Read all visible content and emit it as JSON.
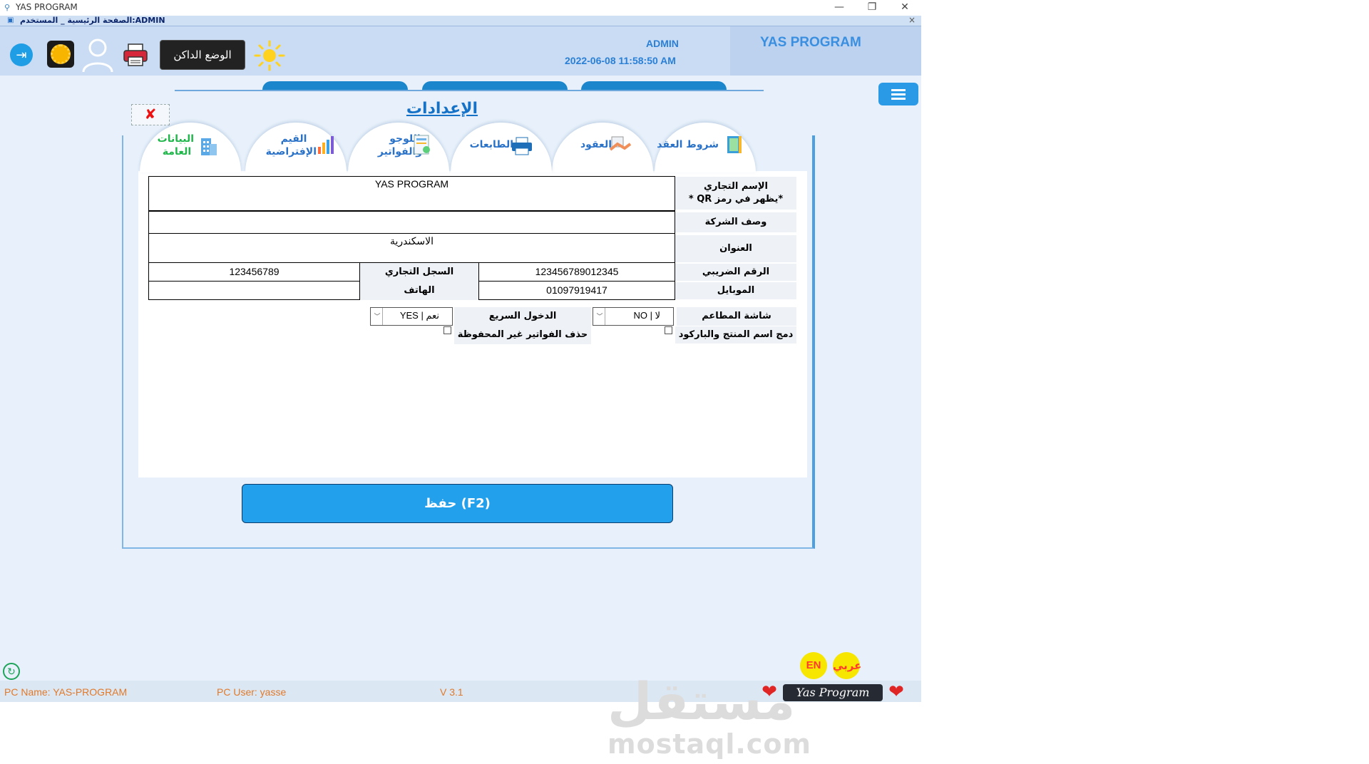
{
  "window": {
    "title": "YAS PROGRAM",
    "minimize": "—",
    "restore": "❐",
    "close": "✕"
  },
  "mdi": {
    "caption": "الصفحة الرئيسية _ المستخدم:ADMIN",
    "close": "×"
  },
  "header": {
    "brand": "YAS PROGRAM",
    "user": "ADMIN",
    "datetime": "2022-06-08 11:58:50 AM",
    "dark_mode_label": "الوضع الداكن",
    "logout_glyph": "⇥"
  },
  "settings": {
    "title": "الإعدادات",
    "close_glyph": "✘",
    "tabs": [
      {
        "label": "شروط العقد",
        "icon": "book-icon"
      },
      {
        "label": "العقود",
        "icon": "handshake-icon"
      },
      {
        "label": "الطابعات",
        "icon": "printer-icon"
      },
      {
        "label": "اللوجو والفواتير",
        "icon": "invoice-icon"
      },
      {
        "label": "القيم الإفتراضية",
        "icon": "bar-chart-icon"
      },
      {
        "label": "البيانات العامة",
        "icon": "building-icon"
      }
    ],
    "active_tab": "البيانات العامة",
    "form": {
      "trade_name_label": "الإسم التجاري",
      "trade_name_note": "*يظهر في رمز QR *",
      "trade_name_value": "YAS PROGRAM",
      "company_desc_label": "وصف الشركة",
      "company_desc_value": "",
      "address_label": "العنوان",
      "address_value": "الاسكندرية",
      "tax_number_label": "الرقم الضريبي",
      "tax_number_value": "123456789012345",
      "commercial_register_label": "السجل التجاري",
      "commercial_register_value": "123456789",
      "mobile_label": "الموبايل",
      "mobile_value": "01097919417",
      "phone_label": "الهاتف",
      "phone_value": "",
      "kitchen_screen_label": "شاشة المطاعم",
      "kitchen_screen_value": "لا | NO",
      "quick_login_label": "الدخول السريع",
      "quick_login_value": "نعم | YES",
      "merge_name_barcode_label": "دمج اسم المنتج والباركود",
      "delete_unsaved_label": "حذف الفواتير غير المحفوظة"
    },
    "save_label": "حفظ (F2)"
  },
  "language": {
    "en": "EN",
    "ar": "عربي"
  },
  "status": {
    "pc_name": "PC Name: YAS-PROGRAM",
    "pc_user": "PC User: yasse",
    "version": "V 3.1",
    "badge": "Yas Program",
    "heart": "❤"
  },
  "watermark": {
    "arabic": "مستقل",
    "latin": "mostaql.com"
  },
  "colors": {
    "accent": "#22a0ec",
    "active_tab": "#1fb64a",
    "tab_text": "#2a72c8"
  }
}
